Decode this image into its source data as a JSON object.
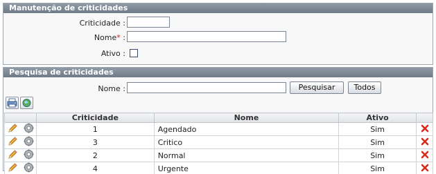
{
  "form": {
    "header": "Manutenção de criticidades",
    "criticidade_label": "Criticidade :",
    "nome_label": "Nome",
    "nome_required": "*",
    "nome_colon": ":",
    "ativo_label": "Ativo :",
    "criticidade_value": "",
    "nome_value": "",
    "ativo_checked": false
  },
  "search": {
    "header": "Pesquisa de criticidades",
    "nome_label": "Nome :",
    "nome_value": "",
    "pesquisar_label": "Pesquisar",
    "todos_label": "Todos"
  },
  "toolbar": {
    "print_icon": "printer-icon",
    "refresh_icon": "globe-refresh-icon"
  },
  "table": {
    "columns": [
      "Criticidade",
      "Nome",
      "Ativo"
    ],
    "rows": [
      {
        "criticidade": "1",
        "nome": "Agendado",
        "ativo": "Sim"
      },
      {
        "criticidade": "3",
        "nome": "Critico",
        "ativo": "Sim"
      },
      {
        "criticidade": "2",
        "nome": "Normal",
        "ativo": "Sim"
      },
      {
        "criticidade": "4",
        "nome": "Urgente",
        "ativo": "Sim"
      }
    ]
  },
  "colors": {
    "header_bg": "#7c8794",
    "delete_red": "#d62a1c",
    "pencil_orange": "#e8a020"
  }
}
